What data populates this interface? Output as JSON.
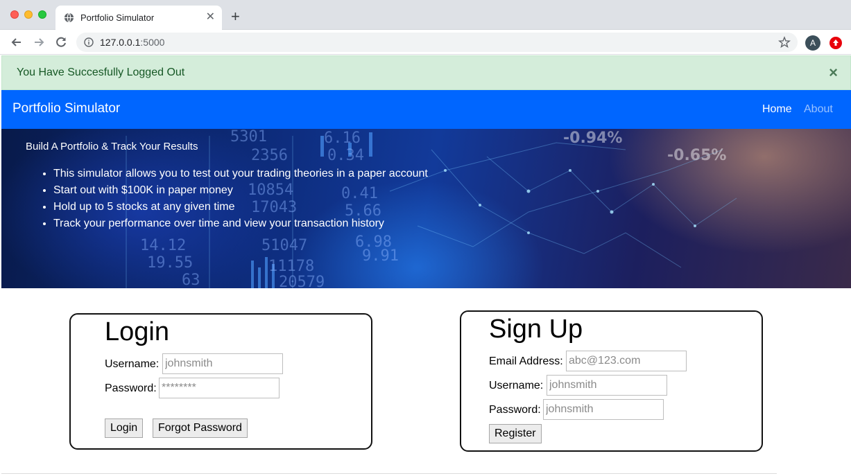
{
  "browser": {
    "tab_title": "Portfolio Simulator",
    "url_host": "127.0.0.1",
    "url_port": ":5000",
    "profile_initial": "A"
  },
  "alert": {
    "message": "You Have Succesfully Logged Out",
    "close": "×"
  },
  "navbar": {
    "brand": "Portfolio Simulator",
    "links": [
      {
        "label": "Home"
      },
      {
        "label": "About"
      }
    ]
  },
  "hero": {
    "title": "Build A Portfolio & Track Your Results",
    "bullets": [
      "This simulator allows you to test out your trading theories in a paper account",
      "Start out with $100K in paper money",
      "Hold up to 5 stocks at any given time",
      "Track your performance over time and view your transaction history"
    ]
  },
  "login": {
    "title": "Login",
    "username_label": "Username:",
    "username_placeholder": "johnsmith",
    "password_label": "Password:",
    "password_placeholder": "********",
    "login_button": "Login",
    "forgot_button": "Forgot Password"
  },
  "signup": {
    "title": "Sign Up",
    "email_label": "Email Address:",
    "email_placeholder": "abc@123.com",
    "username_label": "Username:",
    "username_placeholder": "johnsmith",
    "password_label": "Password:",
    "password_placeholder": "johnsmith",
    "register_button": "Register"
  },
  "colors": {
    "navbar": "#0066ff",
    "alert_bg": "#d4edda",
    "alert_text": "#155724"
  }
}
